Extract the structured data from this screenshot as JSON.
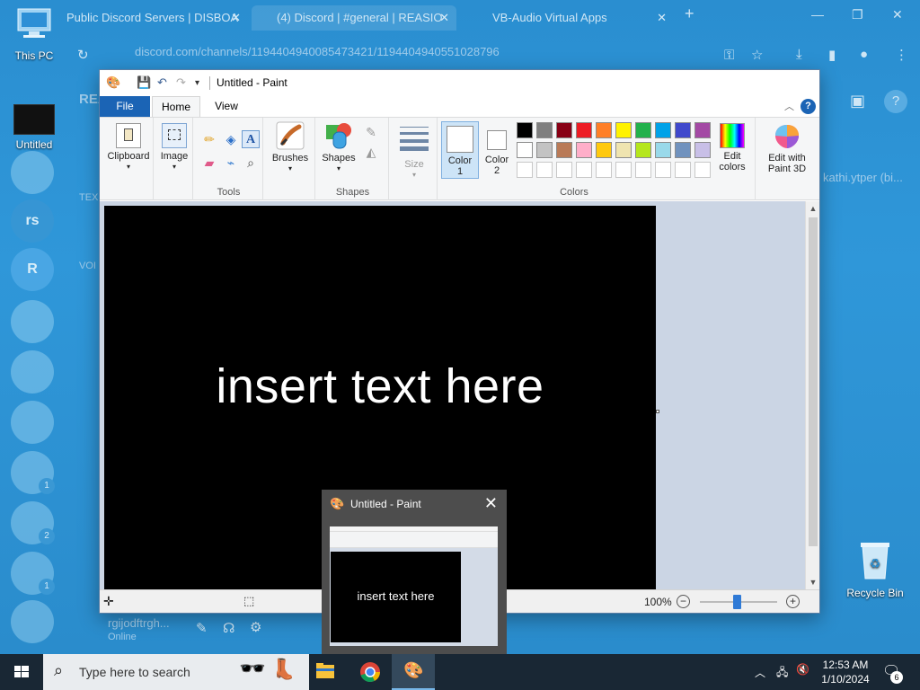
{
  "browser": {
    "tabs": [
      {
        "label": "Public Discord Servers | DISBOA"
      },
      {
        "label": "(4) Discord | #general | REASIO"
      },
      {
        "label": "VB-Audio Virtual Apps"
      }
    ],
    "new_tab": "+",
    "address": "discord.com/channels/1194404940085473421/1194404940551028796"
  },
  "discord": {
    "rail": [
      "rs",
      "R"
    ],
    "badges": [
      "1",
      "2",
      "1"
    ],
    "server_head": "REA",
    "channel_a": "TEX",
    "channel_b": "VOI",
    "right_text": "kathi.ytper (bi...",
    "username": "rgijodftrgh...",
    "user_status": "Online"
  },
  "desktop_icons": {
    "this_pc": "This PC",
    "untitled": "Untitled",
    "recycle_bin": "Recycle Bin"
  },
  "paint": {
    "title": "Untitled - Paint",
    "tabs": {
      "file": "File",
      "home": "Home",
      "view": "View"
    },
    "help": "?",
    "groups": {
      "clipboard": "Clipboard",
      "image": "Image",
      "tools": "Tools",
      "brushes": "Brushes",
      "shapes_btn": "Shapes",
      "shapes_group": "Shapes",
      "size": "Size",
      "color1_a": "Color",
      "color1_b": "1",
      "color2_a": "Color",
      "color2_b": "2",
      "colors_group": "Colors",
      "edit_colors_a": "Edit",
      "edit_colors_b": "colors",
      "edit3d_a": "Edit with",
      "edit3d_b": "Paint 3D"
    },
    "palette_row1": [
      "#000000",
      "#7f7f7f",
      "#880015",
      "#ed1c24",
      "#ff7f27",
      "#fff200",
      "#22b14c",
      "#00a2e8",
      "#3f48cc",
      "#a349a4"
    ],
    "palette_row2": [
      "#ffffff",
      "#c3c3c3",
      "#b97a57",
      "#ffaec9",
      "#ffc90e",
      "#efe4b0",
      "#b5e61d",
      "#99d9ea",
      "#7092be",
      "#c8bfe7"
    ],
    "canvas_text": "insert text here",
    "zoom": "100%",
    "zoom_minus": "−",
    "zoom_plus": "+"
  },
  "preview": {
    "title": "Untitled - Paint",
    "canvas_text": "insert text here"
  },
  "taskbar": {
    "search_placeholder": "Type here to search",
    "time": "12:53 AM",
    "date": "1/10/2024",
    "notif_count": "6"
  }
}
